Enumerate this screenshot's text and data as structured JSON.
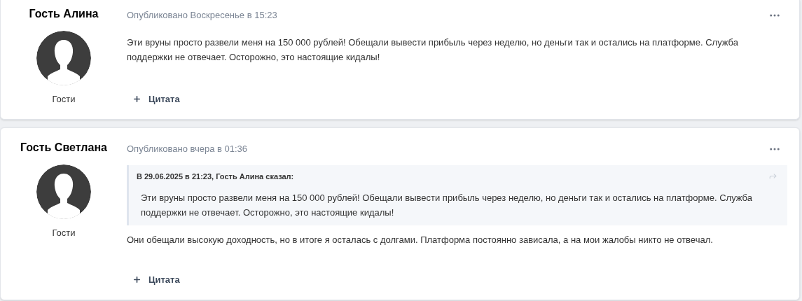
{
  "posts": [
    {
      "author": "Гость Алина",
      "rank": "Гости",
      "posted": "Опубликовано Воскресенье в 15:23",
      "body": "Эти вруны просто развели меня на 150 000 рублей! Обещали вывести прибыль через неделю, но деньги так и остались на платформе. Служба поддержки не отвечает. Осторожно, это настоящие кидалы!",
      "quote_button": "Цитата"
    },
    {
      "author": "Гость Светлана",
      "rank": "Гости",
      "posted": "Опубликовано вчера в 01:36",
      "quote": {
        "header": "В 29.06.2025 в 21:23, Гость Алина сказал:",
        "text": "Эти вруны просто развели меня на 150 000 рублей! Обещали вывести прибыль через неделю, но деньги так и остались на платформе. Служба поддержки не отвечает. Осторожно, это настоящие кидалы!"
      },
      "body": "Они обещали высокую доходность, но в итоге я осталась с долгами. Платформа постоянно зависала, а на мои жалобы никто не отвечал.",
      "quote_button": "Цитата"
    }
  ]
}
